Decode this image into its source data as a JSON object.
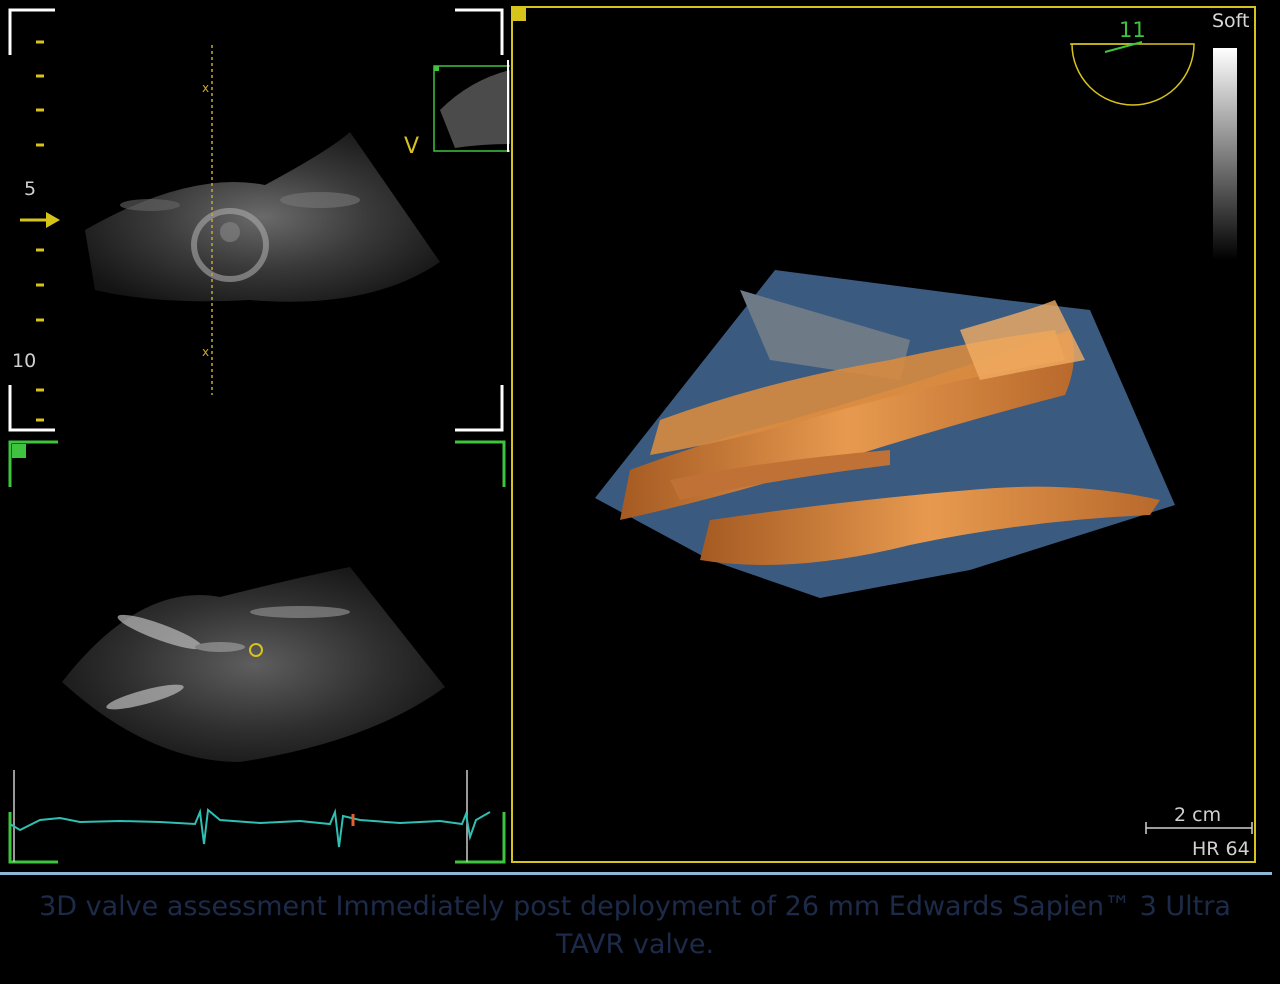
{
  "left_top": {
    "depth_5": "5",
    "depth_10": "10",
    "view_marker": "V"
  },
  "right": {
    "preset": "Soft",
    "angle": "11",
    "scale": "2 cm",
    "heart_rate": "HR 64"
  },
  "caption": "3D valve assessment Immediately post deployment of 26 mm Edwards Sapien™ 3 Ultra TAVR valve.",
  "colors": {
    "frame_white": "#ffffff",
    "frame_green": "#3ec43e",
    "axis_yellow": "#d7c41b",
    "ecg": "#2fbfb3",
    "valve_orange": "#d4833a",
    "blood_blue": "#4a6f99"
  }
}
